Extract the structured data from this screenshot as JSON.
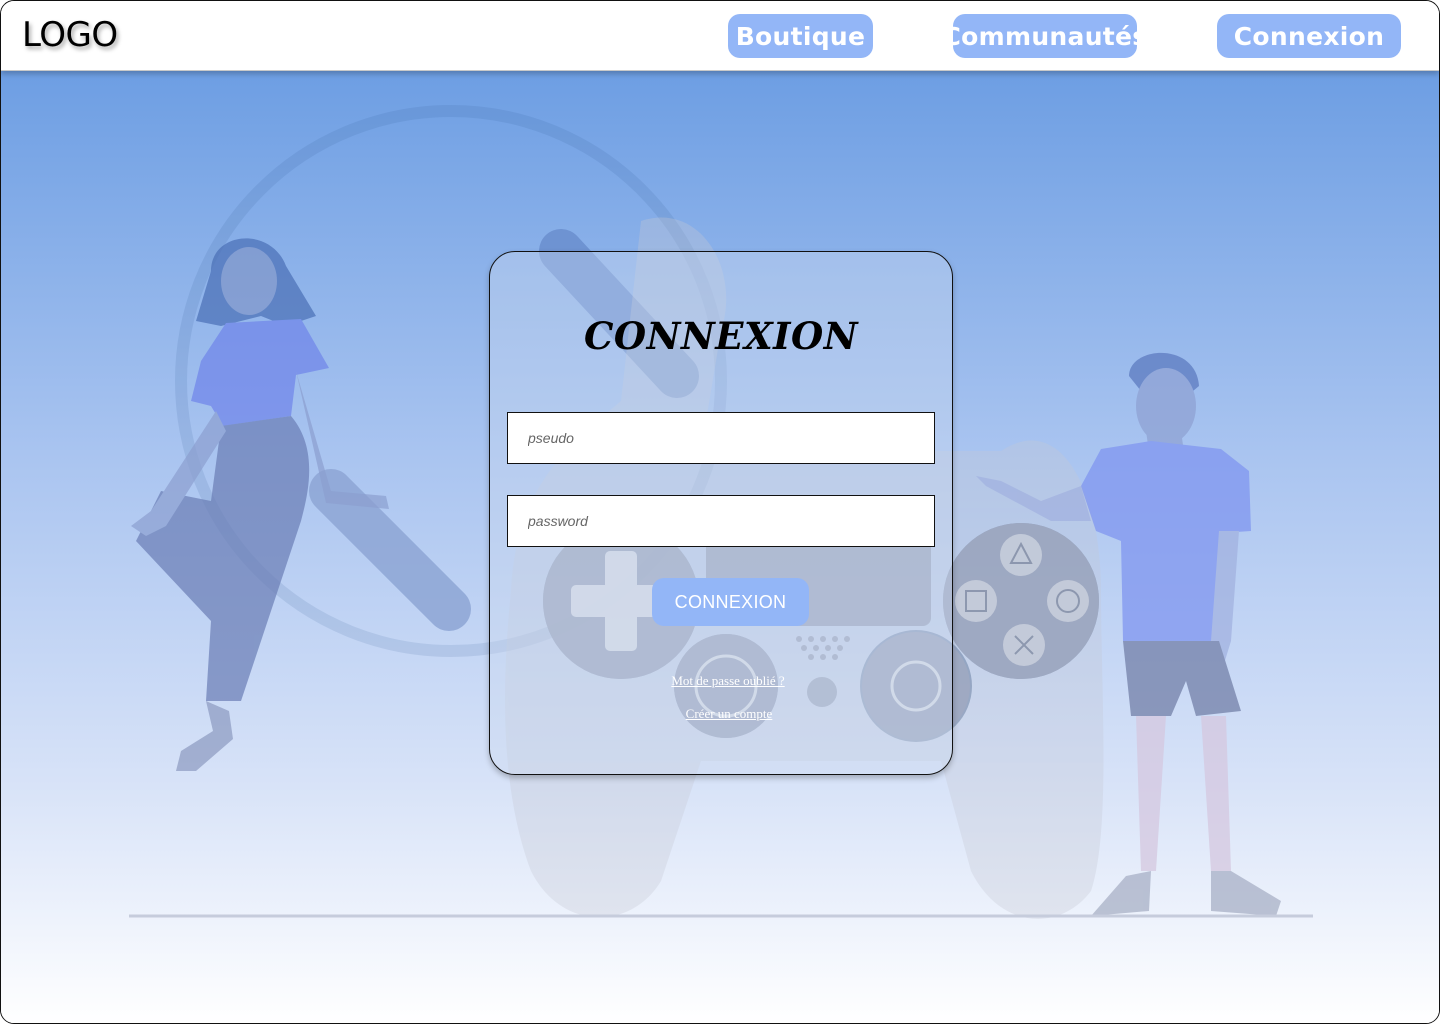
{
  "header": {
    "logo": "LOGO",
    "nav": {
      "boutique": "Boutique",
      "communautes": "Communautés",
      "connexion": "Connexion"
    }
  },
  "login": {
    "title": "CONNEXION",
    "pseudo_placeholder": "pseudo",
    "password_placeholder": "password",
    "submit_label": "CONNEXION",
    "forgot_link": "Mot de passe oublié ?",
    "create_link": "Créer un compte"
  },
  "colors": {
    "accent": "#93b6f7",
    "hero_top": "#6d9ee3",
    "hero_bottom": "#ffffff"
  },
  "illustration": {
    "subject": "gaming-controller-people",
    "icons": [
      "triangle-icon",
      "square-icon",
      "circle-icon",
      "cross-icon",
      "dpad-icon"
    ]
  }
}
